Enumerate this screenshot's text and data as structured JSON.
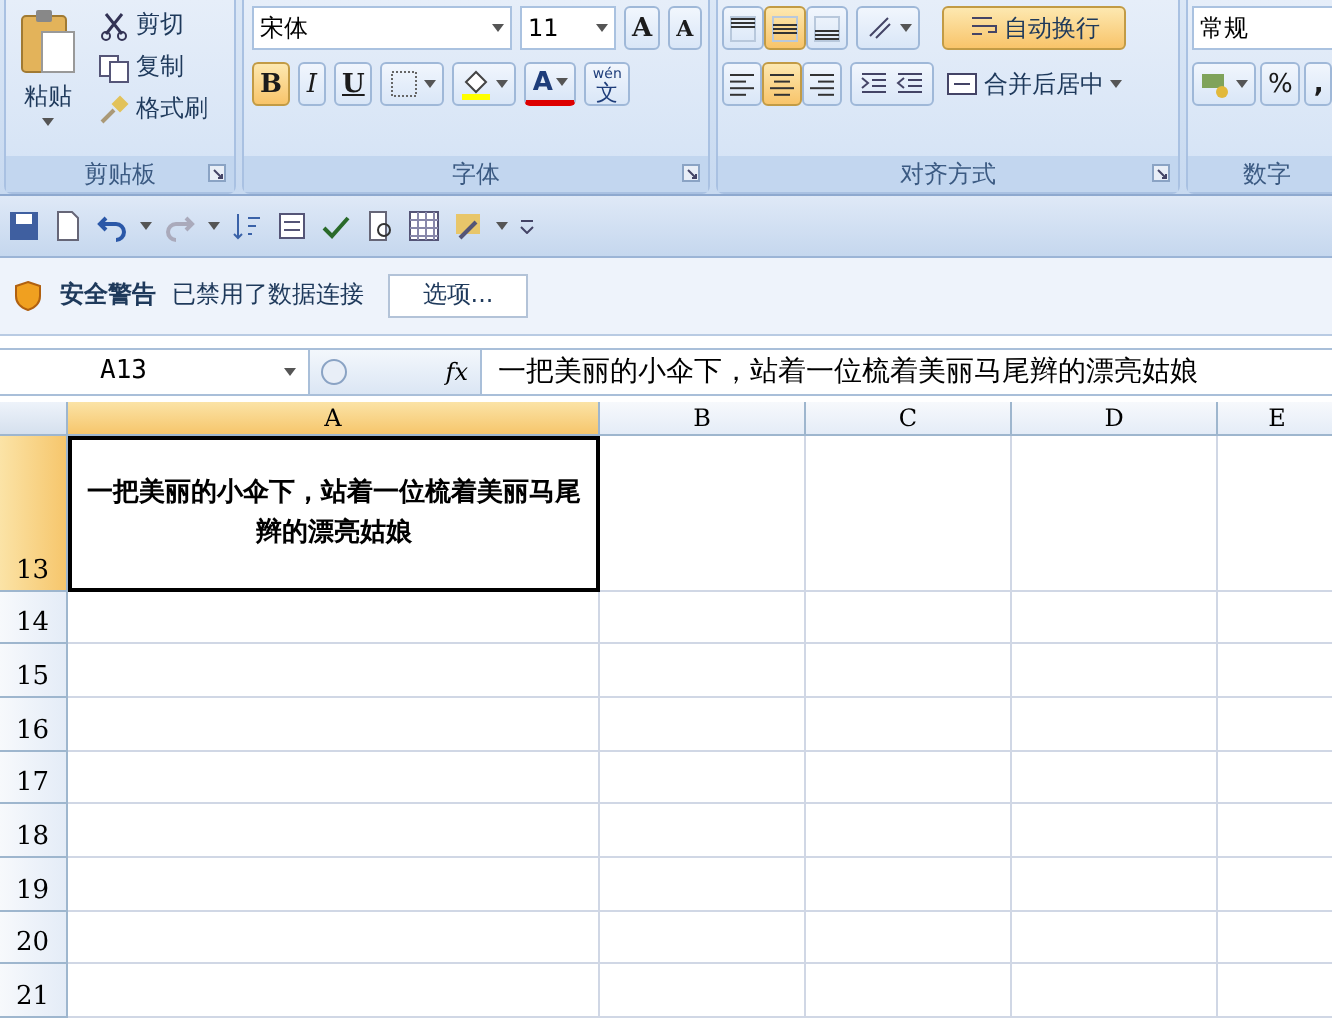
{
  "ribbon": {
    "clipboard": {
      "label": "剪贴板",
      "paste": "粘贴",
      "cut": "剪切",
      "copy": "复制",
      "format_painter": "格式刷"
    },
    "font": {
      "label": "字体",
      "font_name": "宋体",
      "font_size": "11",
      "grow_font": "A",
      "shrink_font": "A",
      "font_color": "A",
      "phonetic_top": "wén",
      "phonetic": "文",
      "styles": [
        {
          "label": "B",
          "kind": "bold",
          "selected": true
        },
        {
          "label": "I",
          "kind": "italic",
          "selected": false
        },
        {
          "label": "U",
          "kind": "underline",
          "selected": false
        }
      ]
    },
    "alignment": {
      "label": "对齐方式",
      "vertical": [
        {
          "kind": "top",
          "selected": false
        },
        {
          "kind": "middle",
          "selected": true
        },
        {
          "kind": "bottom",
          "selected": false
        }
      ],
      "horizontal": [
        {
          "kind": "left",
          "selected": false
        },
        {
          "kind": "center",
          "selected": true
        },
        {
          "kind": "right",
          "selected": false
        }
      ],
      "wrap_text": {
        "label": "自动换行",
        "selected": true
      },
      "merge": {
        "label": "合并后居中"
      }
    },
    "number": {
      "label": "数字",
      "format": "常规",
      "percent": "%",
      "comma": ","
    }
  },
  "security_bar": {
    "title": "安全警告",
    "message": "已禁用了数据连接",
    "button": "选项..."
  },
  "formula_bar": {
    "name_box": "A13",
    "fx": "fx",
    "formula": "一把美丽的小伞下，站着一位梳着美丽马尾辫的漂亮姑娘"
  },
  "sheet": {
    "columns": [
      {
        "label": "A",
        "selected": true
      },
      {
        "label": "B",
        "selected": false
      },
      {
        "label": "C",
        "selected": false
      },
      {
        "label": "D",
        "selected": false
      },
      {
        "label": "E",
        "selected": false
      }
    ],
    "rows": [
      {
        "label": "13",
        "selected": true,
        "kind": "tall",
        "cell_a": "一把美丽的小伞下，站着一位梳着美丽马尾辫的漂亮姑娘"
      },
      {
        "label": "14",
        "selected": false
      },
      {
        "label": "15",
        "selected": false
      },
      {
        "label": "16",
        "selected": false
      },
      {
        "label": "17",
        "selected": false
      },
      {
        "label": "18",
        "selected": false
      },
      {
        "label": "19",
        "selected": false
      },
      {
        "label": "20",
        "selected": false
      },
      {
        "label": "21",
        "selected": false
      }
    ]
  }
}
